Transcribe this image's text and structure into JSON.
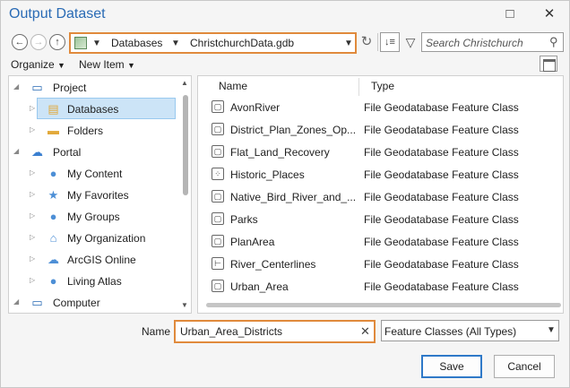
{
  "window": {
    "title": "Output Dataset",
    "maximize_glyph": "□",
    "close_glyph": "✕"
  },
  "toolbar": {
    "back_glyph": "←",
    "forward_glyph": "→",
    "up_glyph": "↑",
    "breadcrumbs": [
      "Databases",
      "ChristchurchData.gdb"
    ],
    "refresh_glyph": "↻",
    "sort_glyph": "↓≡",
    "filter_glyph": "▽",
    "search_placeholder": "Search Christchurch"
  },
  "menubar": {
    "organize": "Organize",
    "new_item": "New Item"
  },
  "tree": {
    "items": [
      {
        "label": "Project",
        "icon": "project-icon",
        "glyph": "▭",
        "color": "#2a6bb5",
        "caret": "◢"
      },
      {
        "label": "Databases",
        "icon": "database-folder-icon",
        "glyph": "▤",
        "color": "#e2a93b",
        "caret": "▷"
      },
      {
        "label": "Folders",
        "icon": "folder-icon",
        "glyph": "▬",
        "color": "#e2a93b",
        "caret": "▷"
      },
      {
        "label": "Portal",
        "icon": "cloud-icon",
        "glyph": "☁",
        "color": "#3a7fd0",
        "caret": "◢"
      },
      {
        "label": "My Content",
        "icon": "my-content-icon",
        "glyph": "●",
        "color": "#4d8fd6",
        "caret": "▷"
      },
      {
        "label": "My Favorites",
        "icon": "favorites-icon",
        "glyph": "★",
        "color": "#4d8fd6",
        "caret": "▷"
      },
      {
        "label": "My Groups",
        "icon": "groups-icon",
        "glyph": "●",
        "color": "#4d8fd6",
        "caret": "▷"
      },
      {
        "label": "My Organization",
        "icon": "organization-icon",
        "glyph": "⌂",
        "color": "#4d8fd6",
        "caret": "▷"
      },
      {
        "label": "ArcGIS Online",
        "icon": "arcgis-online-icon",
        "glyph": "☁",
        "color": "#4d8fd6",
        "caret": "▷"
      },
      {
        "label": "Living Atlas",
        "icon": "living-atlas-icon",
        "glyph": "●",
        "color": "#4d8fd6",
        "caret": "▷"
      },
      {
        "label": "Computer",
        "icon": "computer-icon",
        "glyph": "▭",
        "color": "#2a6bb5",
        "caret": "◢"
      }
    ]
  },
  "filelist": {
    "columns": {
      "name": "Name",
      "type": "Type"
    },
    "rows": [
      {
        "name": "AvonRiver",
        "type": "File Geodatabase Feature Class",
        "icon": "polygon-feature-icon",
        "glyph": "▢"
      },
      {
        "name": "District_Plan_Zones_Op...",
        "type": "File Geodatabase Feature Class",
        "icon": "polygon-feature-icon",
        "glyph": "▢"
      },
      {
        "name": "Flat_Land_Recovery",
        "type": "File Geodatabase Feature Class",
        "icon": "polygon-feature-icon",
        "glyph": "▢"
      },
      {
        "name": "Historic_Places",
        "type": "File Geodatabase Feature Class",
        "icon": "point-feature-icon",
        "glyph": "⁘"
      },
      {
        "name": "Native_Bird_River_and_...",
        "type": "File Geodatabase Feature Class",
        "icon": "polygon-feature-icon",
        "glyph": "▢"
      },
      {
        "name": "Parks",
        "type": "File Geodatabase Feature Class",
        "icon": "polygon-feature-icon",
        "glyph": "▢"
      },
      {
        "name": "PlanArea",
        "type": "File Geodatabase Feature Class",
        "icon": "polygon-feature-icon",
        "glyph": "▢"
      },
      {
        "name": "River_Centerlines",
        "type": "File Geodatabase Feature Class",
        "icon": "line-feature-icon",
        "glyph": "⊢"
      },
      {
        "name": "Urban_Area",
        "type": "File Geodatabase Feature Class",
        "icon": "polygon-feature-icon",
        "glyph": "▢"
      }
    ]
  },
  "footer": {
    "name_label": "Name",
    "name_value": "Urban_Area_Districts",
    "clear_glyph": "✕",
    "type_filter": "Feature Classes (All Types)",
    "save": "Save",
    "cancel": "Cancel"
  },
  "colors": {
    "accent": "#2a6bb5",
    "highlight_border": "#e08a3c",
    "selection": "#cce4f7"
  }
}
